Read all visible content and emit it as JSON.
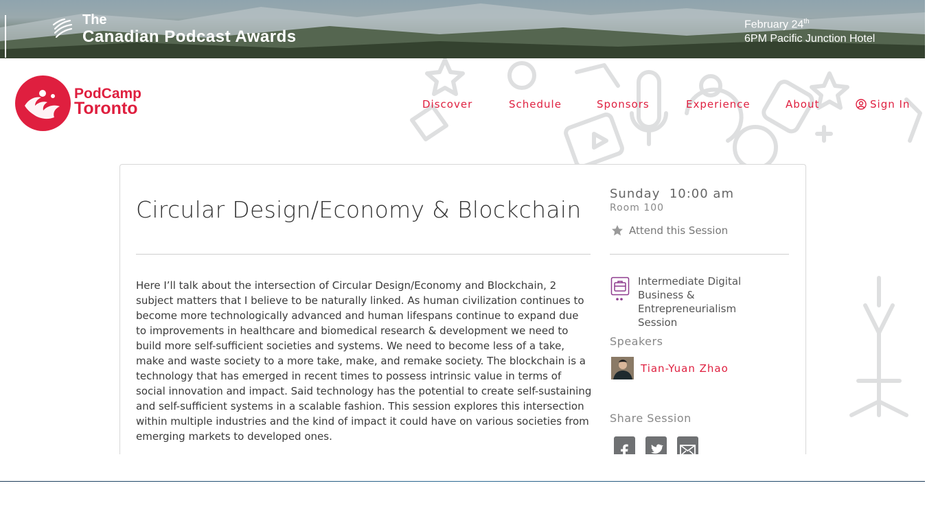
{
  "banner": {
    "the": "The",
    "title": "Canadian Podcast Awards",
    "date": "February 24",
    "date_suffix": "th",
    "venue": "6PM Pacific Junction Hotel"
  },
  "logo": {
    "line1": "PodCamp",
    "line2": "Toronto"
  },
  "nav": {
    "discover": "Discover",
    "schedule": "Schedule",
    "sponsors": "Sponsors",
    "experience": "Experience",
    "about": "About",
    "signin": "Sign In"
  },
  "session": {
    "title": "Circular Design/Economy & Blockchain",
    "description": "Here I’ll talk about the intersection of Circular Design/Economy and Blockchain, 2 subject matters that I believe to be naturally linked. As human civilization continues to become more technologically advanced and human lifespans continue to expand due to improvements in healthcare and biomedical research & development we need to build more self-sufficient societies and systems. We need to become less of a take, make and waste society to a more take, make, and remake society. The blockchain is a technology that has emerged in recent times to possess intrinsic value in terms of social innovation and impact. Said technology has the potential to create self-sustaining and self-sufficient systems in a scalable fashion. This session explores this intersection within multiple industries and the kind of impact it could have on various societies from emerging markets to developed ones.",
    "day": "Sunday",
    "time": "10:00 am",
    "room": "Room 100",
    "attend": "Attend this Session",
    "track": "Intermediate Digital Business & Entrepreneurialism Session",
    "speakers_heading": "Speakers",
    "speaker_name": "Tian-Yuan Zhao",
    "share_heading": "Share Session"
  },
  "colors": {
    "brand": "#df1f3f",
    "track_icon": "#8e3b8e",
    "share_button": "#6f7173"
  }
}
